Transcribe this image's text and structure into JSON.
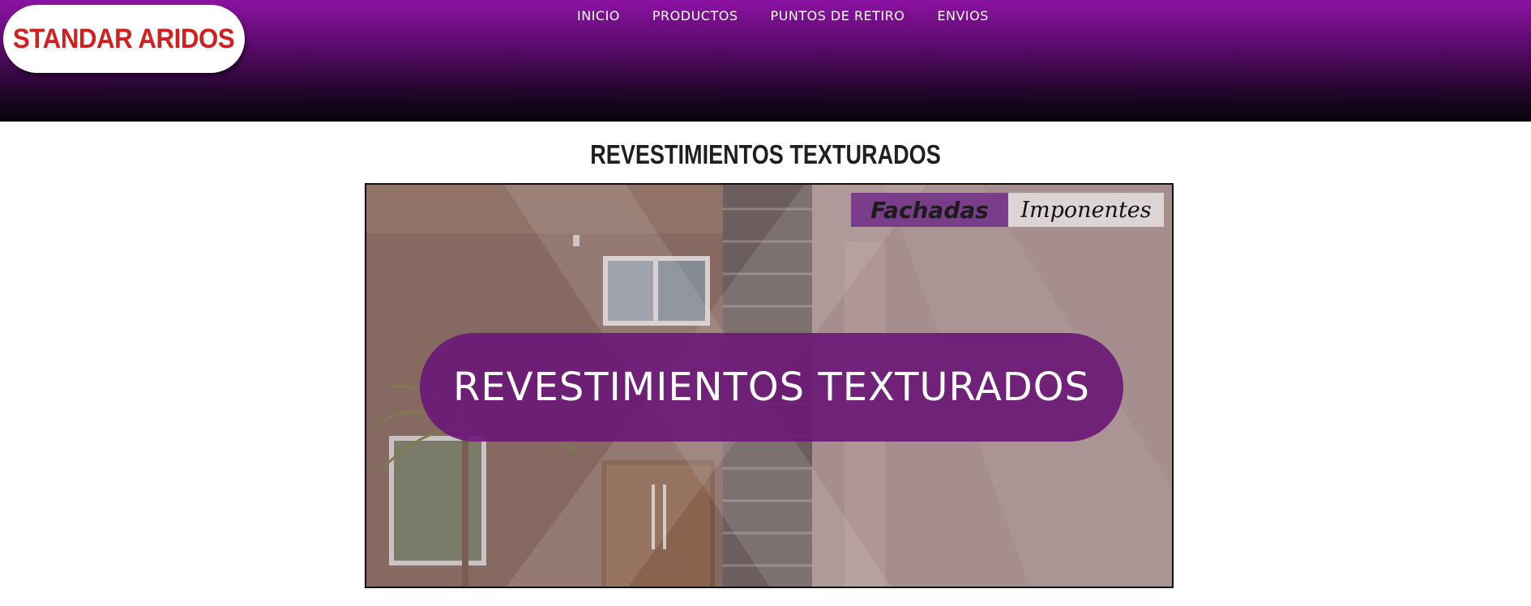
{
  "header": {
    "logo_text": "STANDAR ARIDOS",
    "nav": [
      {
        "label": "INICIO"
      },
      {
        "label": "PRODUCTOS"
      },
      {
        "label": "PUNTOS DE RETIRO"
      },
      {
        "label": "ENVIOS"
      }
    ]
  },
  "main": {
    "title": "REVESTIMIENTOS TEXTURADOS",
    "banner": {
      "tag_left": "Fachadas",
      "tag_right": "Imponentes",
      "headline": "REVESTIMIENTOS TEXTURADOS"
    }
  },
  "colors": {
    "header_top": "#8c12a3",
    "header_bottom": "#07030a",
    "logo_red": "#d21f1f",
    "banner_purple": "#6c1a76"
  }
}
